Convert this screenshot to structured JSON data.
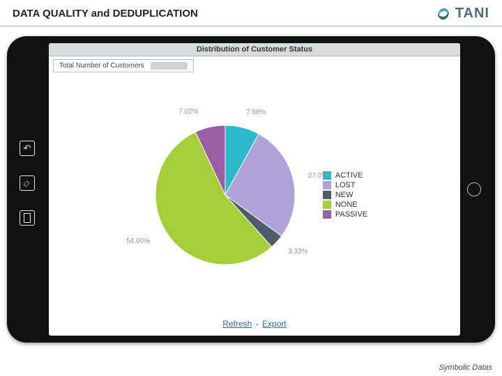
{
  "header": {
    "title": "DATA QUALITY and DEDUPLICATION",
    "brand": "TANI"
  },
  "screen": {
    "chart_title": "Distribution of Customer Status",
    "total_label": "Total Number of Customers",
    "refresh": "Refresh",
    "export": "Export"
  },
  "chart_data": {
    "type": "pie",
    "title": "Distribution of Customer Status",
    "series": [
      {
        "name": "ACTIVE",
        "value": 7.98,
        "color": "#2bb9c9",
        "label": "7.98%"
      },
      {
        "name": "LOST",
        "value": 27.07,
        "color": "#b2a0d8",
        "label": "27.07%"
      },
      {
        "name": "NEW",
        "value": 3.33,
        "color": "#4d5b6a",
        "label": "3.33%"
      },
      {
        "name": "NONE",
        "value": 54.6,
        "color": "#a6ce39",
        "label": "54.60%"
      },
      {
        "name": "PASSIVE",
        "value": 7.02,
        "color": "#9a5ea3",
        "label": "7.02%"
      }
    ]
  },
  "footnote": "Symbolic Datas"
}
